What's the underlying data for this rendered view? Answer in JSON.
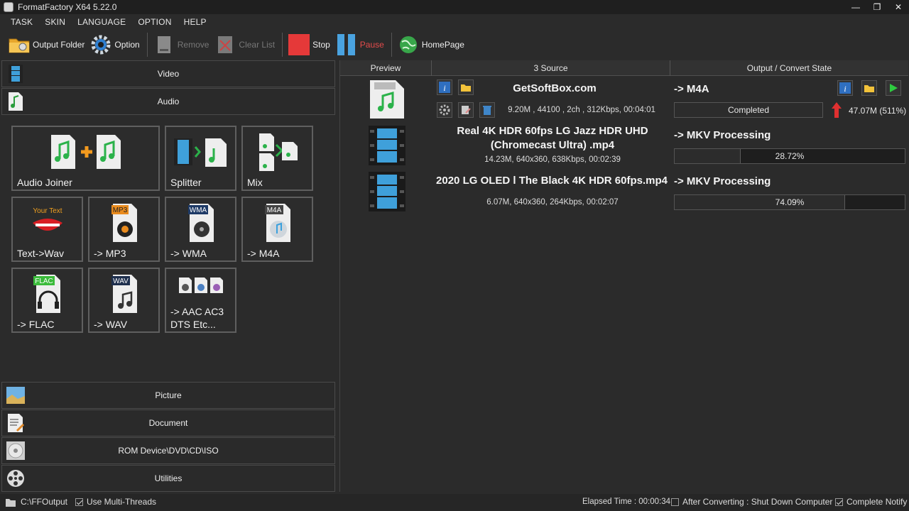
{
  "window": {
    "title": "FormatFactory X64 5.22.0"
  },
  "menu": [
    "TASK",
    "SKIN",
    "LANGUAGE",
    "OPTION",
    "HELP"
  ],
  "toolbar": {
    "output_folder": "Output Folder",
    "option": "Option",
    "remove": "Remove",
    "clear_list": "Clear List",
    "stop": "Stop",
    "pause": "Pause",
    "homepage": "HomePage"
  },
  "categories": {
    "video": "Video",
    "audio": "Audio",
    "picture": "Picture",
    "document": "Document",
    "rom": "ROM Device\\DVD\\CD\\ISO",
    "utilities": "Utilities"
  },
  "audio_tools": [
    {
      "label": "Audio Joiner"
    },
    {
      "label": "Splitter"
    },
    {
      "label": "Mix"
    },
    {
      "label": "Text->Wav",
      "icon_text": "Your Text"
    },
    {
      "label": "-> MP3",
      "badge": "MP3"
    },
    {
      "label": "-> WMA",
      "badge": "WMA"
    },
    {
      "label": "-> M4A",
      "badge": "M4A"
    },
    {
      "label": "-> FLAC",
      "badge": "FLAC"
    },
    {
      "label": "-> WAV",
      "badge": "WAV"
    },
    {
      "label": "-> AAC AC3 DTS Etc..."
    }
  ],
  "task_list": {
    "headers": {
      "preview": "Preview",
      "source": "3 Source",
      "output": "Output / Convert State"
    },
    "rows": [
      {
        "name": "GetSoftBox.com",
        "info": "9.20M , 44100 , 2ch , 312Kbps, 00:04:01",
        "state": "-> M4A",
        "progress_text": "Completed",
        "progress": 1.0,
        "result": "47.07M  (511%)"
      },
      {
        "name": "Real 4K HDR 60fps LG Jazz HDR UHD (Chromecast Ultra) .mp4",
        "info": "14.23M, 640x360, 638Kbps, 00:02:39",
        "state": "-> MKV Processing",
        "progress_text": "28.72%",
        "progress": 0.2872
      },
      {
        "name": "2020 LG OLED l The Black 4K HDR 60fps.mp4",
        "info": "6.07M, 640x360, 264Kbps, 00:02:07",
        "state": "-> MKV Processing",
        "progress_text": "74.09%",
        "progress": 0.7409
      }
    ]
  },
  "statusbar": {
    "output_path": "C:\\FFOutput",
    "multi_threads": "Use Multi-Threads",
    "elapsed": "Elapsed Time : 00:00:34",
    "after_converting": "After Converting : Shut Down Computer",
    "complete_notify": "Complete Notify"
  },
  "colors": {
    "accent_stop": "#e53939",
    "accent_pause": "#4aa3e0",
    "completed_arrow": "#e03030",
    "play_green": "#2ecc40"
  }
}
